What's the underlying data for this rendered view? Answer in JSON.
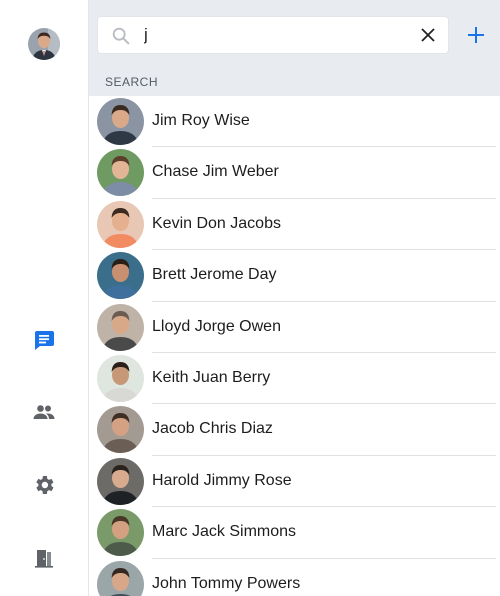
{
  "colors": {
    "accent": "#1a73e8",
    "icon_gray": "#5f6368",
    "search_bg": "#e8ebef"
  },
  "sidebar": {
    "items": [
      {
        "icon": "chat-icon",
        "active": true
      },
      {
        "icon": "people-icon",
        "active": false
      },
      {
        "icon": "settings-gear-icon",
        "active": false
      },
      {
        "icon": "exit-door-icon",
        "active": false
      }
    ]
  },
  "search": {
    "value": "j",
    "placeholder": ""
  },
  "section_label": "SEARCH",
  "contacts": [
    {
      "name": "Jim Roy Wise",
      "bg": "#8a94a3",
      "skin": "#d9a98a",
      "hair": "#3b2a20",
      "shirt": "#2f3946"
    },
    {
      "name": "Chase Jim Weber",
      "bg": "#6f9a62",
      "skin": "#e2b596",
      "hair": "#5a3f2a",
      "shirt": "#7d8da6"
    },
    {
      "name": "Kevin Don Jacobs",
      "bg": "#e8c8b4",
      "skin": "#e4b08e",
      "hair": "#3a2a20",
      "shirt": "#f28a62"
    },
    {
      "name": "Brett Jerome Day",
      "bg": "#3a6e8a",
      "skin": "#c89070",
      "hair": "#2a1e16",
      "shirt": "#3f6f9c"
    },
    {
      "name": "Lloyd Jorge Owen",
      "bg": "#bfb3a8",
      "skin": "#d8a888",
      "hair": "#6a5c50",
      "shirt": "#4a4a4a"
    },
    {
      "name": "Keith Juan Berry",
      "bg": "#dfe6e0",
      "skin": "#c79878",
      "hair": "#2b2019",
      "shirt": "#d8d8d4"
    },
    {
      "name": "Jacob Chris Diaz",
      "bg": "#a39a92",
      "skin": "#d4a184",
      "hair": "#3e2e24",
      "shirt": "#6b5e55"
    },
    {
      "name": "Harold Jimmy Rose",
      "bg": "#6d6b67",
      "skin": "#d9ab8e",
      "hair": "#2a221c",
      "shirt": "#1e2126"
    },
    {
      "name": "Marc Jack Simmons",
      "bg": "#7a9a6a",
      "skin": "#d3a182",
      "hair": "#4a3626",
      "shirt": "#4d5b4a"
    },
    {
      "name": "John Tommy Powers",
      "bg": "#9aa6a8",
      "skin": "#d8a78a",
      "hair": "#352820",
      "shirt": "#3f4d5c"
    }
  ]
}
